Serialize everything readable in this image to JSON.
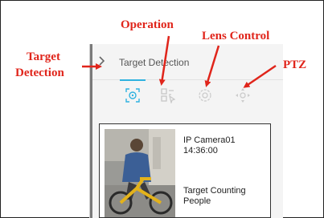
{
  "callouts": {
    "operation": "Operation",
    "lens_control": "Lens Control",
    "target_detection_line1": "Target",
    "target_detection_line2": "Detection",
    "ptz": "PTZ"
  },
  "panel": {
    "title": "Target Detection",
    "tabs": [
      {
        "icon": "target-detection-icon",
        "active": true
      },
      {
        "icon": "operation-icon",
        "active": false
      },
      {
        "icon": "lens-control-icon",
        "active": false
      },
      {
        "icon": "ptz-icon",
        "active": false
      }
    ]
  },
  "event_card": {
    "camera": "IP Camera01",
    "time": "14:36:00",
    "event_line1": "Target Counting",
    "event_line2": "People"
  },
  "colors": {
    "callout": "#e0251b",
    "accent": "#2fb2e0",
    "icon_inactive": "#c7c7c7"
  }
}
